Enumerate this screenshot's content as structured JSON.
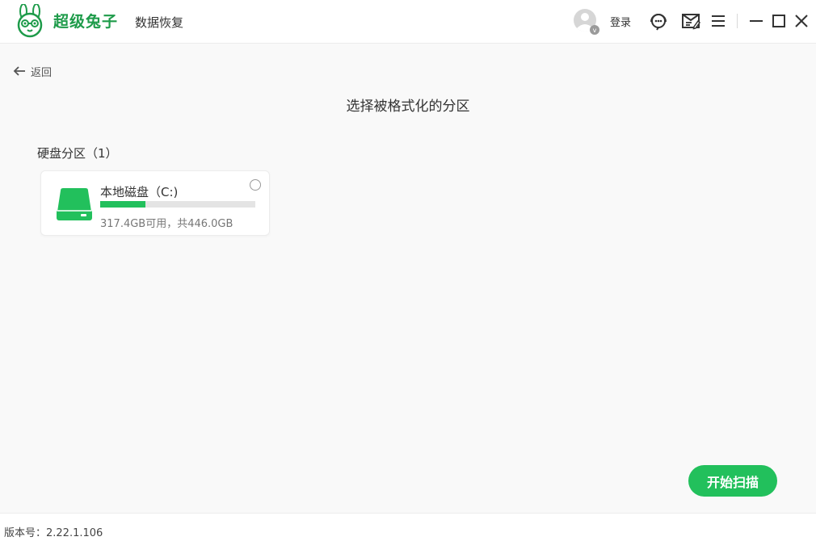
{
  "app": {
    "brand": "超级兔子",
    "subtitle": "数据恢复",
    "login_label": "登录",
    "avatar_badge": "v"
  },
  "colors": {
    "accent": "#22c05c",
    "brand_text": "#1e9b4a",
    "background": "#f9f9f9"
  },
  "icons": {
    "logo": "rabbit-logo-icon",
    "avatar": "user-avatar-icon",
    "support": "customer-service-icon",
    "feedback": "feedback-icon",
    "menu": "menu-icon",
    "minimize": "minimize-icon",
    "maximize": "maximize-icon",
    "close": "close-icon",
    "back": "arrow-left-icon",
    "disk": "hard-disk-icon"
  },
  "nav": {
    "back_label": "返回"
  },
  "main": {
    "title": "选择被格式化的分区",
    "section_title": "硬盘分区（1）",
    "partitions": [
      {
        "name": "本地磁盘（C:)",
        "info": "317.4GB可用，共446.0GB",
        "used_fraction": 0.29,
        "selected": false
      }
    ],
    "scan_button": "开始扫描"
  },
  "footer": {
    "version": "版本号：2.22.1.106"
  }
}
